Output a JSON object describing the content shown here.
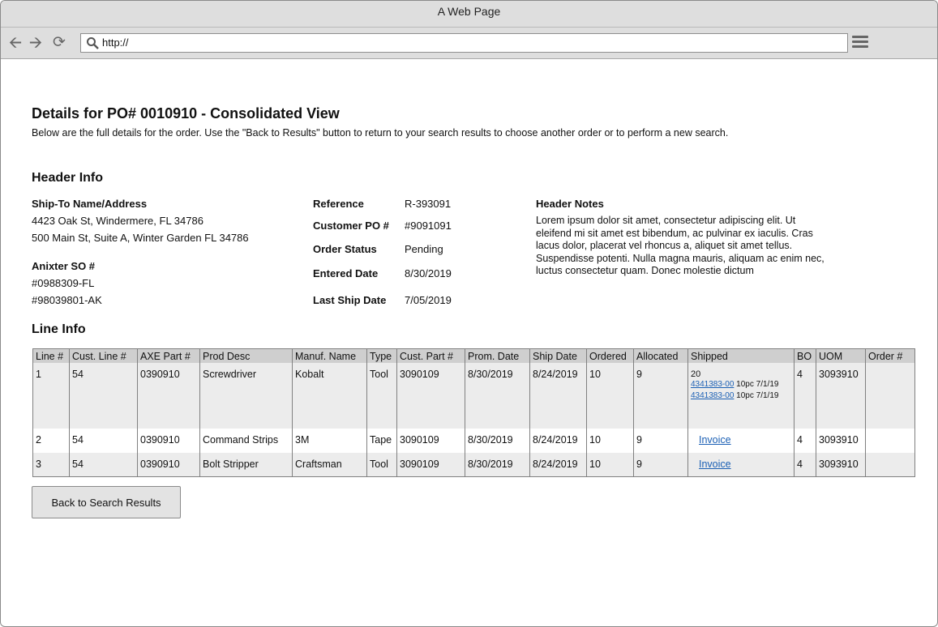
{
  "window": {
    "title": "A Web Page"
  },
  "browser": {
    "url": "http://"
  },
  "page": {
    "title": "Details for PO# 0010910 - Consolidated View",
    "intro": "Below are the full details for the order. Use the \"Back to Results\" button to return to your search results to choose another order or to perform a new search."
  },
  "header_info": {
    "heading": "Header Info",
    "ship_to_label": "Ship-To Name/Address",
    "ship_to_lines": [
      "4423 Oak St, Windermere, FL 34786",
      "500 Main St, Suite A, Winter Garden FL 34786"
    ],
    "so_label": "Anixter SO #",
    "so_numbers": [
      "#0988309-FL",
      "#98039801-AK"
    ],
    "fields": [
      {
        "label": "Reference",
        "value": "R-393091"
      },
      {
        "label": "Customer PO #",
        "value": "#9091091"
      },
      {
        "label": "Order Status",
        "value": "Pending"
      },
      {
        "label": "Entered Date",
        "value": "8/30/2019"
      },
      {
        "label": "Last Ship Date",
        "value": "7/05/2019"
      }
    ],
    "notes_label": "Header Notes",
    "notes": "Lorem ipsum dolor sit amet, consectetur adipiscing elit. Ut eleifend mi sit amet est bibendum, ac pulvinar ex iaculis. Cras lacus dolor, placerat vel rhoncus a, aliquet sit amet tellus. Suspendisse potenti. Nulla magna mauris, aliquam ac enim nec, luctus consectetur quam. Donec molestie dictum"
  },
  "line_info": {
    "heading": "Line Info",
    "columns": [
      "Line #",
      "Cust. Line #",
      "AXE Part #",
      "Prod Desc",
      "Manuf. Name",
      "Type",
      "Cust. Part #",
      "Prom. Date",
      "Ship Date",
      "Ordered",
      "Allocated",
      "Shipped",
      "BO",
      "UOM",
      "Order #"
    ],
    "rows": [
      {
        "line": "1",
        "cust_line": "54",
        "axe_part": "0390910",
        "desc": "Screwdriver",
        "manuf": "Kobalt",
        "type": "Tool",
        "cust_part": "3090109",
        "prom_date": "8/30/2019",
        "ship_date": "8/24/2019",
        "ordered": "10",
        "allocated": "9",
        "shipped_qty": "20",
        "shipments": [
          {
            "link": "4341383-00",
            "detail": "10pc 7/1/19"
          },
          {
            "link": "4341383-00",
            "detail": "10pc 7/1/19"
          }
        ],
        "bo": "4",
        "uom": "3093910",
        "order": ""
      },
      {
        "line": "2",
        "cust_line": "54",
        "axe_part": "0390910",
        "desc": "Command Strips",
        "manuf": "3M",
        "type": "Tape",
        "cust_part": "3090109",
        "prom_date": "8/30/2019",
        "ship_date": "8/24/2019",
        "ordered": "10",
        "allocated": "9",
        "invoice": "Invoice",
        "bo": "4",
        "uom": "3093910",
        "order": ""
      },
      {
        "line": "3",
        "cust_line": "54",
        "axe_part": "0390910",
        "desc": "Bolt Stripper",
        "manuf": "Craftsman",
        "type": "Tool",
        "cust_part": "3090109",
        "prom_date": "8/30/2019",
        "ship_date": "8/24/2019",
        "ordered": "10",
        "allocated": "9",
        "invoice": "Invoice",
        "bo": "4",
        "uom": "3093910",
        "order": ""
      }
    ]
  },
  "actions": {
    "back_label": "Back to Search Results"
  }
}
